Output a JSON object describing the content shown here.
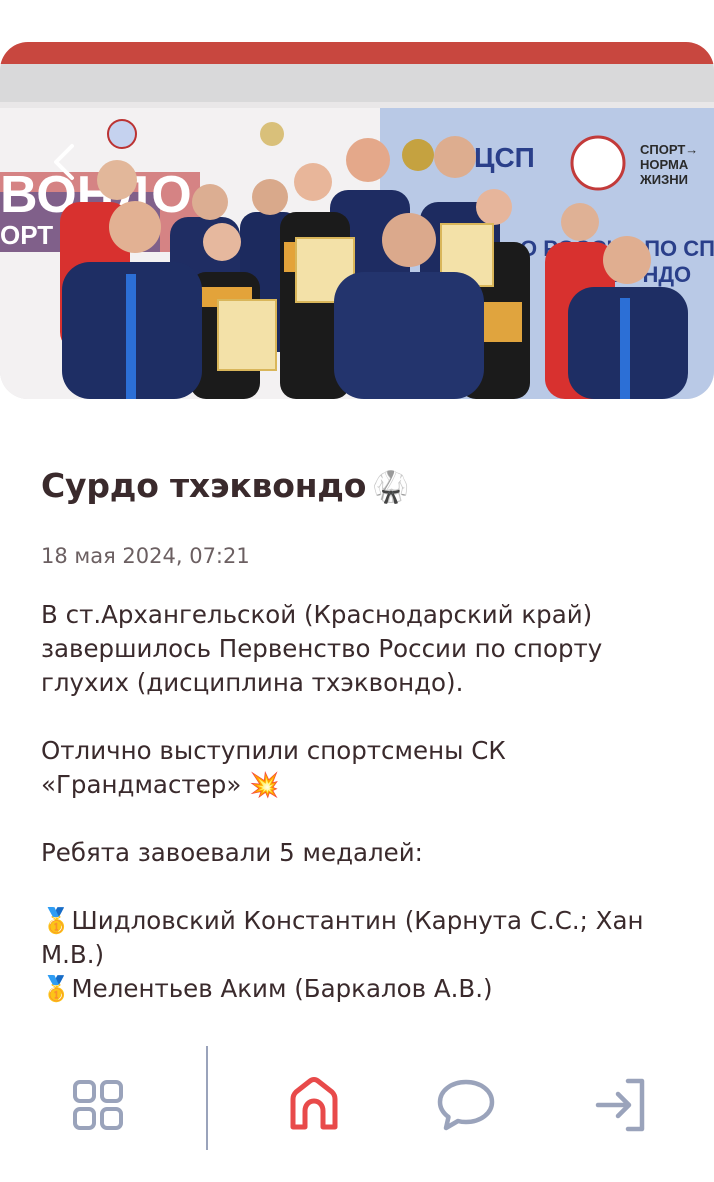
{
  "post": {
    "title": "Сурдо тхэквондо",
    "title_emoji": "🥋",
    "date": "18 мая 2024, 07:21",
    "paragraphs": [
      [
        "В ст.Архангельской (Краснодарский край)",
        "завершилось Первенство России по спорту",
        "глухих (дисциплина тхэквондо)."
      ],
      [
        "Отлично выступили спортсмены СК",
        "«Грандмастер» 💥"
      ],
      [
        "Ребята завоевали 5 медалей:"
      ],
      [
        "🥇Шидловский Константин (Карнута С.С.; Хан",
        "М.В.)",
        "🥇Мелентьев Аким (Баркалов А.В.)"
      ]
    ]
  },
  "photo": {
    "description_icon": "team-photo",
    "banner_texts": [
      "ВОНДО",
      "ОРТ",
      "ЦСП",
      "СПОРТ→",
      "НОРМА",
      "ЖИЗНИ",
      "О РОССИИ ПО СП",
      "ВОНДО"
    ]
  },
  "nav": {
    "items": [
      {
        "icon": "grid-icon",
        "active": false
      },
      {
        "icon": "home-icon",
        "active": true
      },
      {
        "icon": "chat-icon",
        "active": false
      },
      {
        "icon": "login-icon",
        "active": false
      }
    ]
  },
  "colors": {
    "accent": "#e84a4a",
    "nav_icon": "#9aa3bb",
    "text": "#3a2a2c",
    "muted": "#6b5f61"
  }
}
